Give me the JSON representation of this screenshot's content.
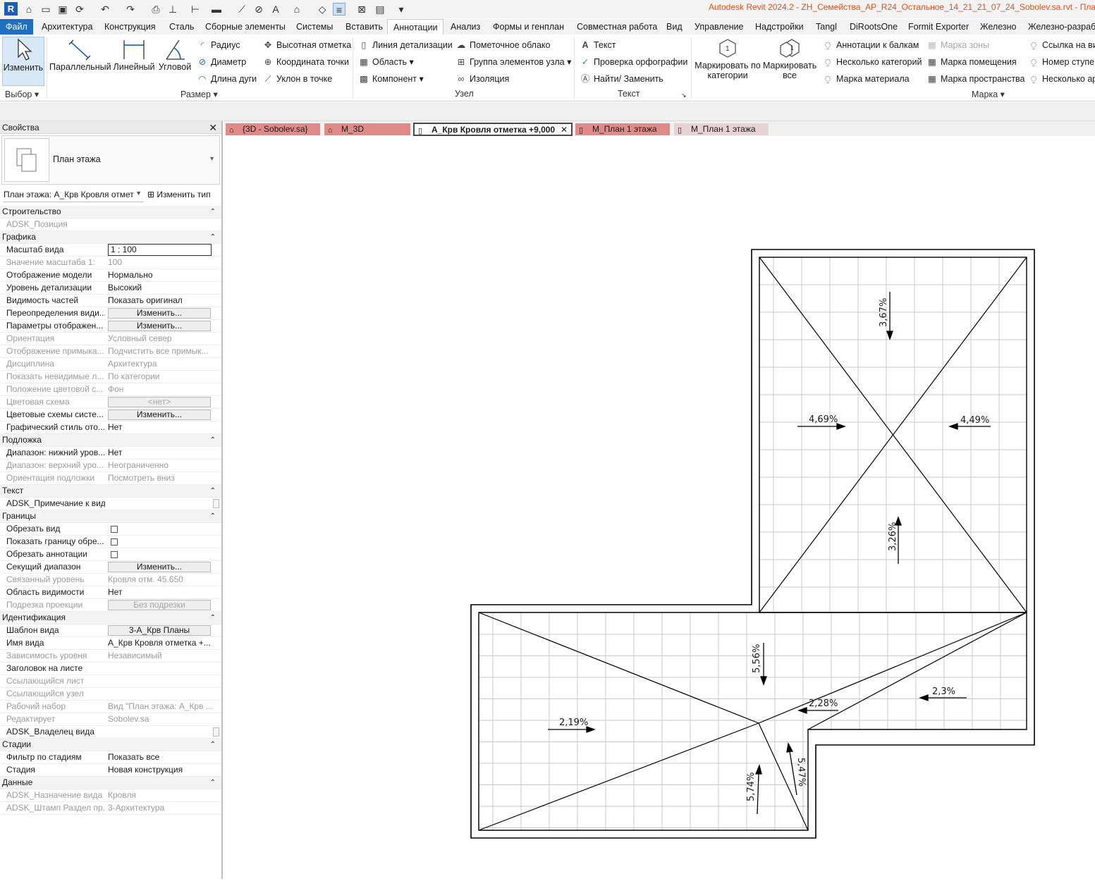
{
  "app": {
    "logo": "R",
    "title": "Autodesk Revit 2024.2 - ZH_Семейства_АР_R24_Остальное_14_21_21_07_24_Sobolev.sa.rvt - План эта"
  },
  "ribbon_tabs": [
    "Файл",
    "Архитектура",
    "Конструкция",
    "Сталь",
    "Сборные элементы",
    "Системы",
    "Вставить",
    "Аннотации",
    "Анализ",
    "Формы и генплан",
    "Совместная работа",
    "Вид",
    "Управление",
    "Надстройки",
    "Tangl",
    "DiRootsOne",
    "Formit Exporter",
    "Железно",
    "Железно-разраб"
  ],
  "ribbon": {
    "select": {
      "modify": "Изменить",
      "panel": "Выбор"
    },
    "dimension": {
      "aligned": "Параллельный",
      "linear": "Линейный",
      "angular": "Угловой",
      "radius": "Радиус",
      "diameter": "Диаметр",
      "arc_length": "Длина дуги",
      "spot_elevation": "Высотная отметка",
      "spot_coordinate": "Координата точки",
      "spot_slope": "Уклон  в точке",
      "panel": "Размер"
    },
    "detail": {
      "detail_line": "Линия детализации",
      "region": "Область",
      "component": "Компонент",
      "revision_cloud": "Пометочное облако",
      "detail_group": "Группа элементов узла",
      "insulation": "Изоляция",
      "panel": "Узел"
    },
    "text": {
      "text": "Текст",
      "spelling": "Проверка  орфографии",
      "find_replace": "Найти/ Заменить",
      "panel": "Текст"
    },
    "tag": {
      "by_category": "Маркировать по категории",
      "tag_all": "Маркировать все",
      "beam_annotations": "Аннотации к балкам",
      "multi_category": "Несколько категорий",
      "material_tag": "Марка материала",
      "area_tag": "Марка зоны",
      "room_tag": "Марка помещения",
      "space_tag": "Марка пространства",
      "view_ref": "Ссылка на ви",
      "tread_number": "Номер  ступе",
      "multi_ref": "Несколько  ар",
      "panel": "Марка"
    }
  },
  "properties": {
    "title": "Свойства",
    "type_name": "План этажа",
    "instance": "План этажа: А_Крв Кровля отмет",
    "edit_type": "Изменить тип",
    "rows": [
      {
        "kind": "group",
        "label": "Строительство"
      },
      {
        "kind": "text",
        "label": "ADSK_Позиция",
        "value": "",
        "dim": true
      },
      {
        "kind": "group",
        "label": "Графика"
      },
      {
        "kind": "box",
        "label": "Масштаб вида",
        "value": "1 : 100"
      },
      {
        "kind": "text",
        "label": "Значение масштаба    1:",
        "value": "100",
        "dim": true
      },
      {
        "kind": "text",
        "label": "Отображение модели",
        "value": "Нормально"
      },
      {
        "kind": "text",
        "label": "Уровень детализации",
        "value": "Высокий"
      },
      {
        "kind": "text",
        "label": "Видимость частей",
        "value": "Показать оригинал"
      },
      {
        "kind": "btn",
        "label": "Переопределения види...",
        "value": "Изменить..."
      },
      {
        "kind": "btn",
        "label": "Параметры отображен...",
        "value": "Изменить..."
      },
      {
        "kind": "text",
        "label": "Ориентация",
        "value": "Условный север",
        "dim": true
      },
      {
        "kind": "text",
        "label": "Отображение примыка...",
        "value": "Подчистить все примык...",
        "dim": true
      },
      {
        "kind": "text",
        "label": "Дисциплина",
        "value": "Архитектура",
        "dim": true
      },
      {
        "kind": "text",
        "label": "Показать невидимые л...",
        "value": "По категории",
        "dim": true
      },
      {
        "kind": "text",
        "label": "Положение цветовой с...",
        "value": "Фон",
        "dim": true
      },
      {
        "kind": "btn",
        "label": "Цветовая схема",
        "value": "<нет>",
        "dim": true
      },
      {
        "kind": "btn",
        "label": "Цветовые схемы систе...",
        "value": "Изменить..."
      },
      {
        "kind": "text",
        "label": "Графический стиль ото...",
        "value": "Нет"
      },
      {
        "kind": "group",
        "label": "Подложка"
      },
      {
        "kind": "text",
        "label": "Диапазон: нижний уров...",
        "value": "Нет"
      },
      {
        "kind": "text",
        "label": "Диапазон: верхний уро...",
        "value": "Неограниченно",
        "dim": true
      },
      {
        "kind": "text",
        "label": "Ориентация подложки",
        "value": "Посмотреть вниз",
        "dim": true
      },
      {
        "kind": "group",
        "label": "Текст"
      },
      {
        "kind": "scroll",
        "label": "ADSK_Примечание к виду",
        "value": ""
      },
      {
        "kind": "group",
        "label": "Границы"
      },
      {
        "kind": "check",
        "label": "Обрезать вид",
        "value": ""
      },
      {
        "kind": "check",
        "label": "Показать границу обре...",
        "value": ""
      },
      {
        "kind": "check",
        "label": "Обрезать аннотации",
        "value": ""
      },
      {
        "kind": "btn",
        "label": "Секущий диапазон",
        "value": "Изменить..."
      },
      {
        "kind": "text",
        "label": "Связанный уровень",
        "value": "Кровля отм. 45.650",
        "dim": true
      },
      {
        "kind": "text",
        "label": "Область видимости",
        "value": "Нет"
      },
      {
        "kind": "btn",
        "label": "Подрезка проекции",
        "value": "Без подрезки",
        "dim": true
      },
      {
        "kind": "group",
        "label": "Идентификация"
      },
      {
        "kind": "btn",
        "label": "Шаблон вида",
        "value": "3-А_Крв Планы"
      },
      {
        "kind": "text",
        "label": "Имя вида",
        "value": "А_Крв Кровля отметка +..."
      },
      {
        "kind": "text",
        "label": "Зависимость уровня",
        "value": "Независимый",
        "dim": true
      },
      {
        "kind": "text",
        "label": "Заголовок на листе",
        "value": ""
      },
      {
        "kind": "text",
        "label": "Ссылающийся лист",
        "value": "",
        "dim": true
      },
      {
        "kind": "text",
        "label": "Ссылающийся узел",
        "value": "",
        "dim": true
      },
      {
        "kind": "text",
        "label": "Рабочий набор",
        "value": "Вид \"План этажа: А_Крв ...",
        "dim": true
      },
      {
        "kind": "text",
        "label": "Редактирует",
        "value": "Sobolev.sa",
        "dim": true
      },
      {
        "kind": "scroll",
        "label": "ADSK_Владелец вида",
        "value": ""
      },
      {
        "kind": "group",
        "label": "Стадии"
      },
      {
        "kind": "text",
        "label": "Фильтр по стадиям",
        "value": "Показать все"
      },
      {
        "kind": "text",
        "label": "Стадия",
        "value": "Новая конструкция"
      },
      {
        "kind": "group",
        "label": "Данные"
      },
      {
        "kind": "text",
        "label": "ADSK_Назначение вида",
        "value": "Кровля",
        "dim": true
      },
      {
        "kind": "text",
        "label": "ADSK_Штамп Раздел пр...",
        "value": "3-Архитектура",
        "dim": true
      }
    ]
  },
  "view_tabs": [
    {
      "label": "{3D - Sobolev.sa}",
      "style": "red"
    },
    {
      "label": "М_3D",
      "style": "red"
    },
    {
      "label": "А_Крв Кровля отметка +9,000",
      "style": "active"
    },
    {
      "label": "М_План 1 этажа",
      "style": "red"
    },
    {
      "label": "М_План 1 этажа",
      "style": "light"
    }
  ],
  "slope_labels": [
    "3,67%",
    "4,69%",
    "4,49%",
    "3,26%",
    "5,56%",
    "2,28%",
    "2,3%",
    "2,19%",
    "5,74%",
    "5,47%"
  ],
  "colors": {
    "file_tab": "#1f6ec2",
    "title": "#d9531e",
    "view_tab_red": "#e08a8a"
  }
}
